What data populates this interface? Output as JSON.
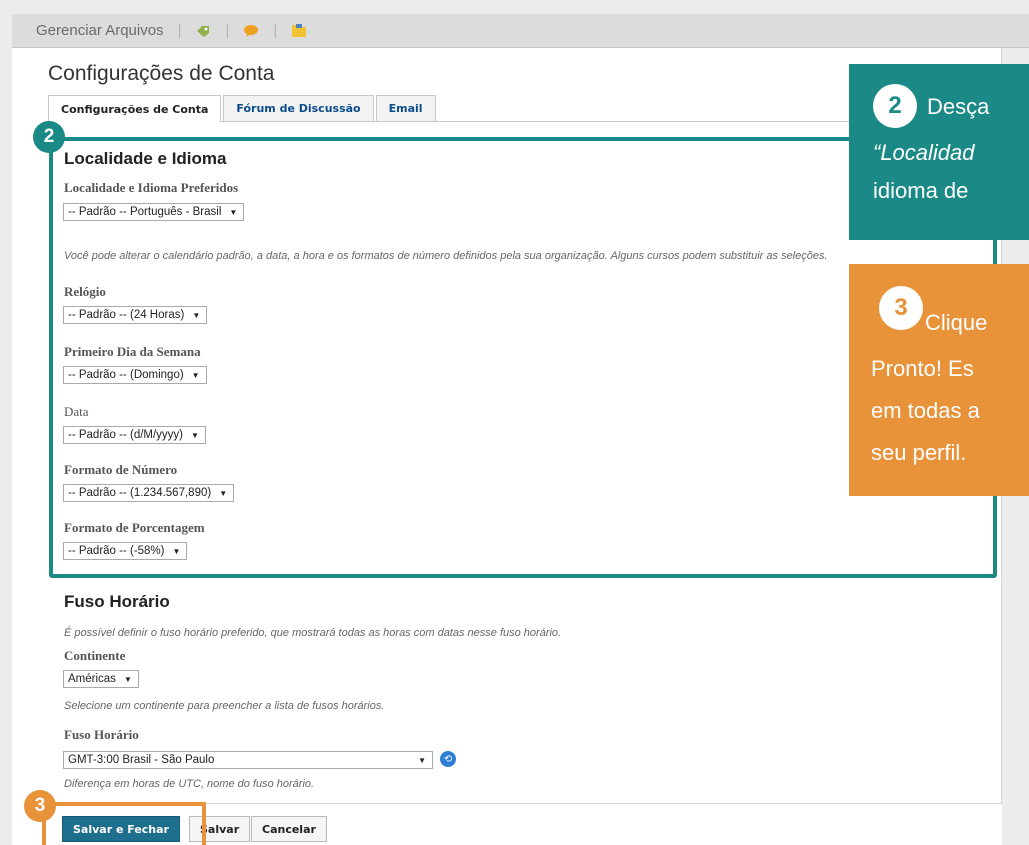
{
  "toolbar": {
    "title": "Gerenciar Arquivos",
    "separator": "|",
    "icons": [
      "tag-icon",
      "chat-icon",
      "folder-icon"
    ]
  },
  "page": {
    "title": "Configurações de Conta",
    "tabs": [
      {
        "label": "Configurações de Conta",
        "active": true
      },
      {
        "label": "Fórum de Discussão",
        "active": false
      },
      {
        "label": "Email",
        "active": false
      }
    ]
  },
  "locale": {
    "section_title": "Localidade e Idioma",
    "preferred_label": "Localidade e Idioma Preferidos",
    "preferred_value": "-- Padrão -- Português - Brasil",
    "note": "Você pode alterar o calendário padrão, a data, a hora e os formatos de número definidos pela sua organização. Alguns cursos podem substituir as seleções.",
    "clock_label": "Relógio",
    "clock_value": "-- Padrão -- (24 Horas)",
    "first_day_label": "Primeiro Dia da Semana",
    "first_day_value": "-- Padrão -- (Domingo)",
    "date_label": "Data",
    "date_value": "-- Padrão -- (d/M/yyyy)",
    "number_label": "Formato de Número",
    "number_value": "-- Padrão -- (1.234.567,890)",
    "percent_label": "Formato de Porcentagem",
    "percent_value": "-- Padrão -- (-58%)"
  },
  "timezone": {
    "section_title": "Fuso Horário",
    "intro": "É possível definir o fuso horário preferido, que mostrará todas as horas com datas nesse fuso horário.",
    "continent_label": "Continente",
    "continent_value": "Américas",
    "continent_help": "Selecione um continente para preencher a lista de fusos horários.",
    "tz_label": "Fuso Horário",
    "tz_value": "GMT-3:00 Brasil - São Paulo",
    "tz_help": "Diferença em horas de UTC, nome do fuso horário."
  },
  "buttons": {
    "save_close": "Salvar e Fechar",
    "save": "Salvar",
    "cancel": "Cancelar"
  },
  "callouts": {
    "step2": {
      "number": "2",
      "line1": "Desça",
      "line2": "“Localidad",
      "line3": "idioma de"
    },
    "step3": {
      "number": "3",
      "line1": "Clique",
      "line2": "Pronto! Es",
      "line3": "em todas a",
      "line4": "seu perfil."
    },
    "badge2": "2",
    "badge3": "3"
  },
  "colors": {
    "teal": "#1b8a86",
    "orange": "#e8923a",
    "primary_button": "#1e6f8e"
  }
}
